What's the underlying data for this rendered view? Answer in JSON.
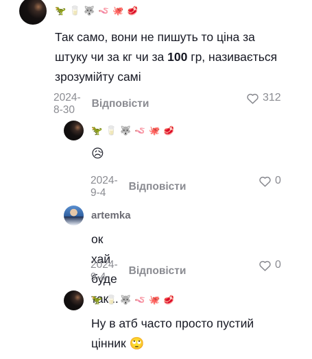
{
  "comments": [
    {
      "badges": [
        "🦖",
        "🥛",
        "🐺",
        "🪱",
        "🐙",
        "🥩"
      ],
      "text_pre": "Так само, вони не пишуть то ціна за штуку чи за кг чи за ",
      "text_bold": "100",
      "text_post": " гр, називається зрозумійту самі",
      "date": "2024-8-30",
      "reply_label": "Відповісти",
      "likes": "312"
    },
    {
      "badges": [
        "🦖",
        "🥛",
        "🐺",
        "🪱",
        "🐙",
        "🥩"
      ],
      "text": "😥",
      "date": "2024-9-4",
      "reply_label": "Відповісти",
      "likes": "0"
    },
    {
      "username": "artemka",
      "text": "ок хай буде так...",
      "date": "2024-9-4",
      "reply_label": "Відповісти",
      "likes": "0"
    },
    {
      "badges": [
        "🦖",
        "🥛",
        "🐺",
        "🪱",
        "🐙",
        "🥩"
      ],
      "text_line1": "Ну в атб часто просто пустий",
      "text_line2": "цінник 🙄"
    }
  ],
  "colors": {
    "text": "#161823",
    "muted": "#8a8b91"
  },
  "icons": {
    "like": "heart-outline-icon"
  }
}
